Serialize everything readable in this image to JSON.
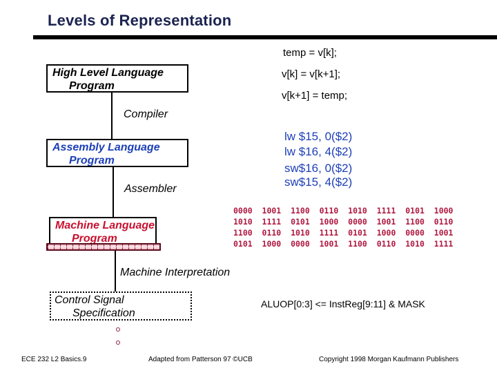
{
  "title": "Levels of Representation",
  "levels": {
    "high_level": {
      "line1": "High Level Language",
      "line2": "Program"
    },
    "assembly": {
      "line1": "Assembly  Language",
      "line2": "Program"
    },
    "machine": {
      "line1": "Machine  Language",
      "line2": "Program"
    },
    "control": {
      "line1": "Control Signal",
      "line2": "Specification"
    }
  },
  "steps": {
    "compiler": "Compiler",
    "assembler": "Assembler",
    "machine_interpretation": "Machine Interpretation"
  },
  "high_level_code": [
    "temp = v[k];",
    "v[k] = v[k+1];",
    "v[k+1] = temp;"
  ],
  "assembly_code": [
    "lw $15, 0($2)",
    "lw $16, 4($2)",
    "sw$16, 0($2)",
    "sw$15, 4($2)"
  ],
  "machine_code": [
    "0000  1001  1100  0110  1010  1111  0101  1000",
    "1010  1111  0101  1000  0000  1001  1100  0110",
    "1100  0110  1010  1111  0101  1000  0000  1001",
    "0101  1000  0000  1001  1100  0110  1010  1111"
  ],
  "control_signal": "ALUOP[0:3] <= InstReg[9:11] & MASK",
  "footer": {
    "left": "ECE 232  L2 Basics.9",
    "center": "Adapted from Patterson 97 ©UCB",
    "right": "Copyright 1998 Morgan Kaufmann Publishers"
  },
  "colors": {
    "title": "#1b2350",
    "assembly": "#1c3fb8",
    "machine": "#c8102e"
  }
}
